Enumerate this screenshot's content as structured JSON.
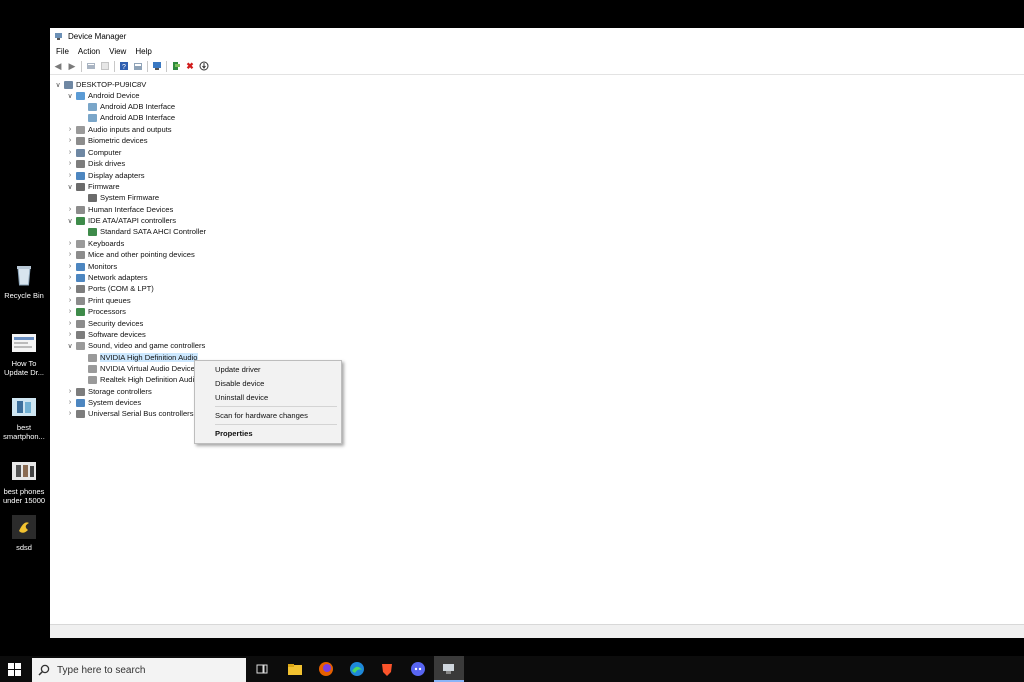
{
  "desktop": {
    "icons": [
      {
        "label": "Recycle Bin",
        "icon": "recycle-bin-icon"
      },
      {
        "label": "How To Update Dr...",
        "icon": "document-thumbnail-icon"
      },
      {
        "label": "best smartphon...",
        "icon": "image-thumbnail-icon"
      },
      {
        "label": "best phones under 15000",
        "icon": "image-thumbnail-icon"
      },
      {
        "label": "sdsd",
        "icon": "app-icon"
      }
    ]
  },
  "window": {
    "title": "Device Manager",
    "menu": [
      "File",
      "Action",
      "View",
      "Help"
    ],
    "toolbar_icons": [
      "back-arrow-icon",
      "forward-arrow-icon",
      "properties-icon",
      "update-driver-icon",
      "help-icon",
      "view-icon",
      "scan-hardware-icon",
      "add-legacy-icon",
      "uninstall-icon",
      "disable-icon"
    ]
  },
  "tree": {
    "root": "DESKTOP-PU9IC8V",
    "items": [
      {
        "label": "Android Device",
        "expanded": true,
        "icon": "android-device-icon"
      },
      {
        "label": "Android ADB Interface",
        "child": true,
        "icon": "adb-interface-icon"
      },
      {
        "label": "Android ADB Interface",
        "child": true,
        "icon": "adb-interface-icon"
      },
      {
        "label": "Audio inputs and outputs",
        "icon": "speaker-icon"
      },
      {
        "label": "Biometric devices",
        "icon": "biometric-icon"
      },
      {
        "label": "Computer",
        "icon": "computer-icon"
      },
      {
        "label": "Disk drives",
        "icon": "disk-drive-icon"
      },
      {
        "label": "Display adapters",
        "icon": "display-adapter-icon"
      },
      {
        "label": "Firmware",
        "expanded": true,
        "icon": "firmware-icon"
      },
      {
        "label": "System Firmware",
        "child": true,
        "icon": "firmware-chip-icon"
      },
      {
        "label": "Human Interface Devices",
        "icon": "hid-icon"
      },
      {
        "label": "IDE ATA/ATAPI controllers",
        "expanded": true,
        "icon": "ide-controller-icon"
      },
      {
        "label": "Standard SATA AHCI Controller",
        "child": true,
        "icon": "sata-controller-icon"
      },
      {
        "label": "Keyboards",
        "icon": "keyboard-icon"
      },
      {
        "label": "Mice and other pointing devices",
        "icon": "mouse-icon"
      },
      {
        "label": "Monitors",
        "icon": "monitor-icon"
      },
      {
        "label": "Network adapters",
        "icon": "network-adapter-icon"
      },
      {
        "label": "Ports (COM & LPT)",
        "icon": "port-icon"
      },
      {
        "label": "Print queues",
        "icon": "printer-icon"
      },
      {
        "label": "Processors",
        "icon": "processor-icon"
      },
      {
        "label": "Security devices",
        "icon": "security-device-icon"
      },
      {
        "label": "Software devices",
        "icon": "software-device-icon"
      },
      {
        "label": "Sound, video and game controllers",
        "expanded": true,
        "icon": "sound-controller-icon"
      },
      {
        "label": "NVIDIA High Definition Audio",
        "child": true,
        "selected": true,
        "icon": "audio-device-icon"
      },
      {
        "label": "NVIDIA Virtual Audio Device",
        "child": true,
        "icon": "audio-device-icon"
      },
      {
        "label": "Realtek High Definition Audio",
        "child": true,
        "icon": "audio-device-icon"
      },
      {
        "label": "Storage controllers",
        "icon": "storage-controller-icon"
      },
      {
        "label": "System devices",
        "icon": "system-device-icon"
      },
      {
        "label": "Universal Serial Bus controllers",
        "icon": "usb-icon"
      }
    ]
  },
  "context_menu": {
    "items": [
      "Update driver",
      "Disable device",
      "Uninstall device",
      "Scan for hardware changes",
      "Properties"
    ]
  },
  "taskbar": {
    "search_placeholder": "Type here to search",
    "icons": [
      "start-icon",
      "search-icon",
      "task-view-icon",
      "file-explorer-icon",
      "firefox-icon",
      "edge-icon",
      "brave-icon",
      "discord-icon",
      "device-manager-icon"
    ]
  },
  "colors": {
    "selection": "#cce8ff",
    "taskbar": "#0c0c0c",
    "menu_bg": "#f2f2f2"
  }
}
